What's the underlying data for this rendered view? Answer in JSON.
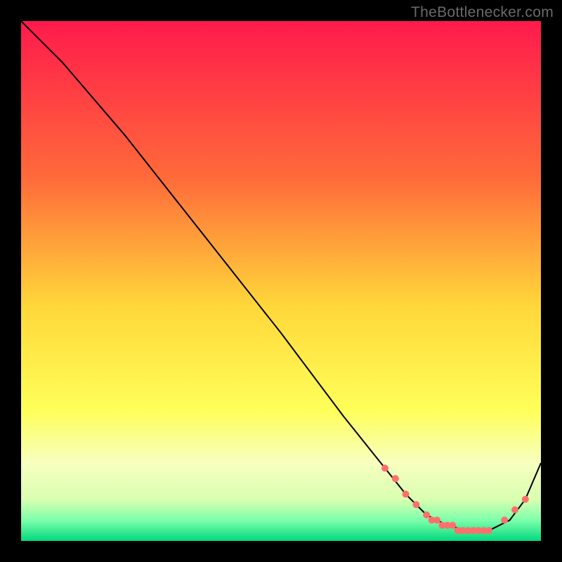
{
  "watermark": "TheBottlenecker.com",
  "chart_data": {
    "type": "line",
    "title": "",
    "xlabel": "",
    "ylabel": "",
    "xlim": [
      0,
      100
    ],
    "ylim": [
      0,
      100
    ],
    "background_gradient": {
      "stops": [
        {
          "offset": 0.0,
          "color": "#ff1a4c"
        },
        {
          "offset": 0.3,
          "color": "#ff6a3a"
        },
        {
          "offset": 0.55,
          "color": "#ffd83a"
        },
        {
          "offset": 0.75,
          "color": "#ffff5a"
        },
        {
          "offset": 0.85,
          "color": "#f7ffbf"
        },
        {
          "offset": 0.92,
          "color": "#d9ffb0"
        },
        {
          "offset": 0.96,
          "color": "#7dffab"
        },
        {
          "offset": 1.0,
          "color": "#00d97e"
        }
      ]
    },
    "series": [
      {
        "name": "bottleneck-curve",
        "x": [
          0,
          3,
          8,
          20,
          35,
          50,
          62,
          70,
          74,
          78,
          82,
          86,
          90,
          94,
          97,
          100
        ],
        "y": [
          100,
          97,
          92,
          78,
          59,
          40,
          24,
          14,
          9,
          5,
          3,
          2,
          2,
          4,
          8,
          15
        ]
      }
    ],
    "markers": {
      "name": "highlighted-range",
      "color": "#ff6f6c",
      "points": [
        {
          "x": 70,
          "y": 14
        },
        {
          "x": 72,
          "y": 12
        },
        {
          "x": 74,
          "y": 9
        },
        {
          "x": 76,
          "y": 7
        },
        {
          "x": 78,
          "y": 5
        },
        {
          "x": 79,
          "y": 4
        },
        {
          "x": 80,
          "y": 4
        },
        {
          "x": 81,
          "y": 3
        },
        {
          "x": 82,
          "y": 3
        },
        {
          "x": 83,
          "y": 3
        },
        {
          "x": 84,
          "y": 2
        },
        {
          "x": 85,
          "y": 2
        },
        {
          "x": 86,
          "y": 2
        },
        {
          "x": 87,
          "y": 2
        },
        {
          "x": 88,
          "y": 2
        },
        {
          "x": 89,
          "y": 2
        },
        {
          "x": 90,
          "y": 2
        },
        {
          "x": 93,
          "y": 4
        },
        {
          "x": 95,
          "y": 6
        },
        {
          "x": 97,
          "y": 8
        }
      ]
    }
  }
}
